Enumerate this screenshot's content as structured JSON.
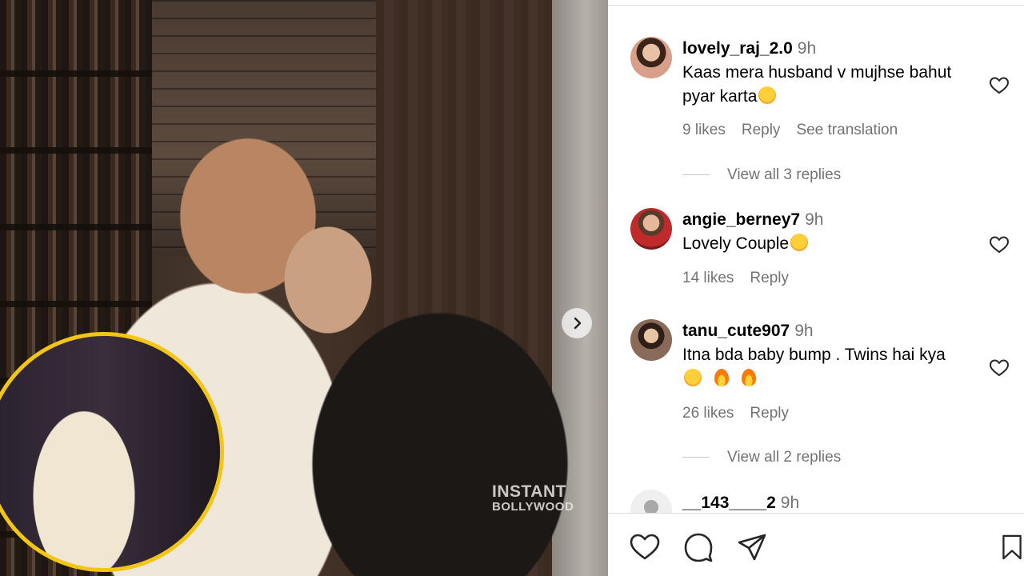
{
  "photo": {
    "watermark_line1": "INSTANT",
    "watermark_line2": "BOLLYWOOD",
    "next_icon": "chevron-right-icon",
    "inset_border_color": "#f3c515"
  },
  "comments": [
    {
      "username": "lovely_raj_2.0",
      "time": "9h",
      "text": "Kaas mera husband v mujhse bahut pyar karta",
      "emojis": [
        "flushed-emoji"
      ],
      "likes": "9 likes",
      "reply": "Reply",
      "translate": "See translation",
      "view_replies": "View all 3 replies",
      "avatar_color": "#c98a7a"
    },
    {
      "username": "angie_berney7",
      "time": "9h",
      "text": "Lovely Couple",
      "emojis": [
        "kiss-emoji"
      ],
      "likes": "14 likes",
      "reply": "Reply",
      "avatar_color": "#b03030"
    },
    {
      "username": "tanu_cute907",
      "time": "9h",
      "text": "Itna bda baby bump . Twins hai kya",
      "emojis": [
        "flushed-emoji",
        "fire-emoji",
        "fire-emoji"
      ],
      "likes": "26 likes",
      "reply": "Reply",
      "view_replies": "View all 2 replies",
      "avatar_color": "#6b4a3a"
    },
    {
      "username": "__143____2",
      "time": "9h",
      "avatar_color": "#e0e0e0"
    }
  ],
  "actions": {
    "like_icon": "heart-icon",
    "comment_icon": "comment-icon",
    "share_icon": "send-icon",
    "save_icon": "bookmark-icon"
  },
  "colors": {
    "muted_text": "#737373",
    "divider": "#dbdbdb"
  }
}
